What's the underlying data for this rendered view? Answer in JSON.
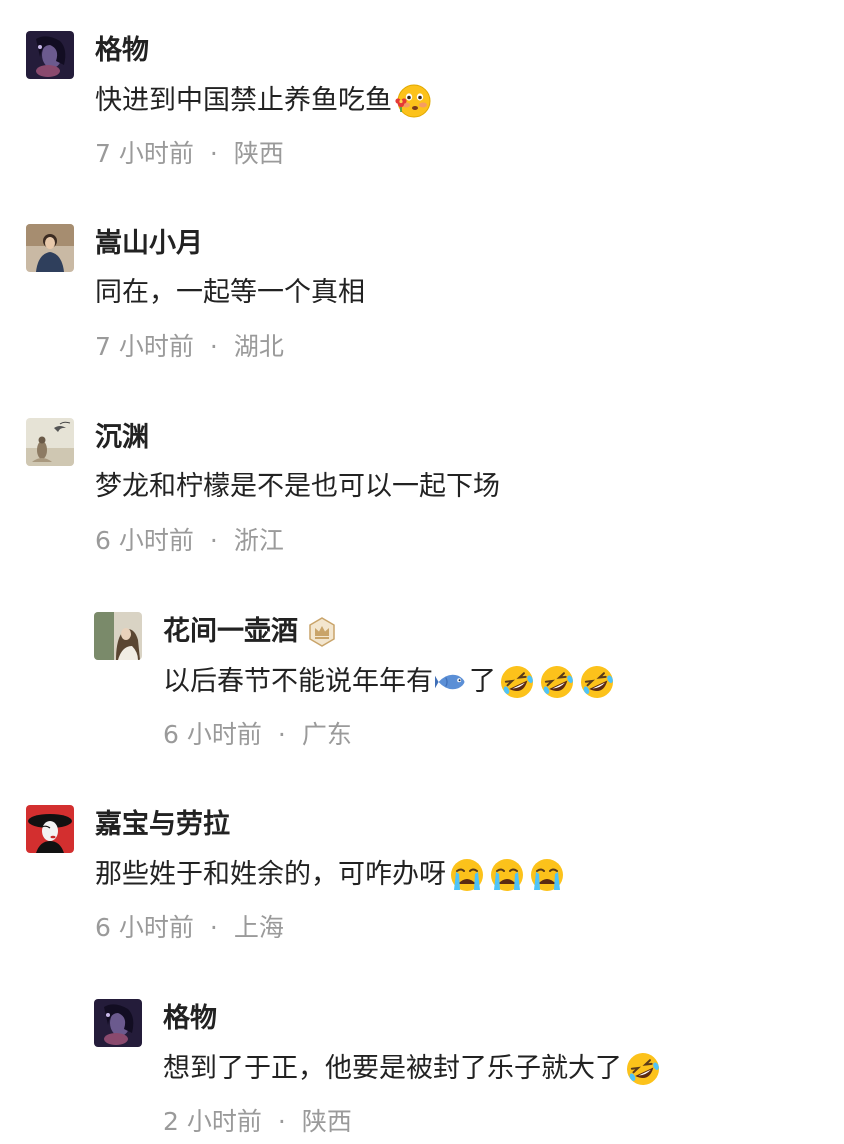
{
  "comments": [
    {
      "name": "格物",
      "text": "快进到中国禁止养鱼吃鱼",
      "emojis": [
        "flushed-face-with-flower"
      ],
      "time": "7 小时前",
      "separator": "·",
      "location": "陕西"
    },
    {
      "name": "嵩山小月",
      "text": "同在，一起等一个真相",
      "emojis": [],
      "time": "7 小时前",
      "separator": "·",
      "location": "湖北"
    },
    {
      "name": "沉渊",
      "text": "梦龙和柠檬是不是也可以一起下场",
      "emojis": [],
      "time": "6 小时前",
      "separator": "·",
      "location": "浙江"
    },
    {
      "name": "花间一壶酒",
      "badge": "crown-badge",
      "text": "以后春节不能说年年有",
      "text_after": "了",
      "inline_emoji": "fish",
      "emojis": [
        "rolling-on-floor-laughing",
        "rolling-on-floor-laughing",
        "rolling-on-floor-laughing"
      ],
      "time": "6 小时前",
      "separator": "·",
      "location": "广东"
    },
    {
      "name": "嘉宝与劳拉",
      "text": "那些姓于和姓余的，可咋办呀",
      "emojis": [
        "loudly-crying-face",
        "loudly-crying-face",
        "loudly-crying-face"
      ],
      "time": "6 小时前",
      "separator": "·",
      "location": "上海"
    },
    {
      "name": "格物",
      "text": "想到了于正，他要是被封了乐子就大了",
      "emojis": [
        "rolling-on-floor-laughing"
      ],
      "time": "2 小时前",
      "separator": "·",
      "location": "陕西"
    }
  ]
}
